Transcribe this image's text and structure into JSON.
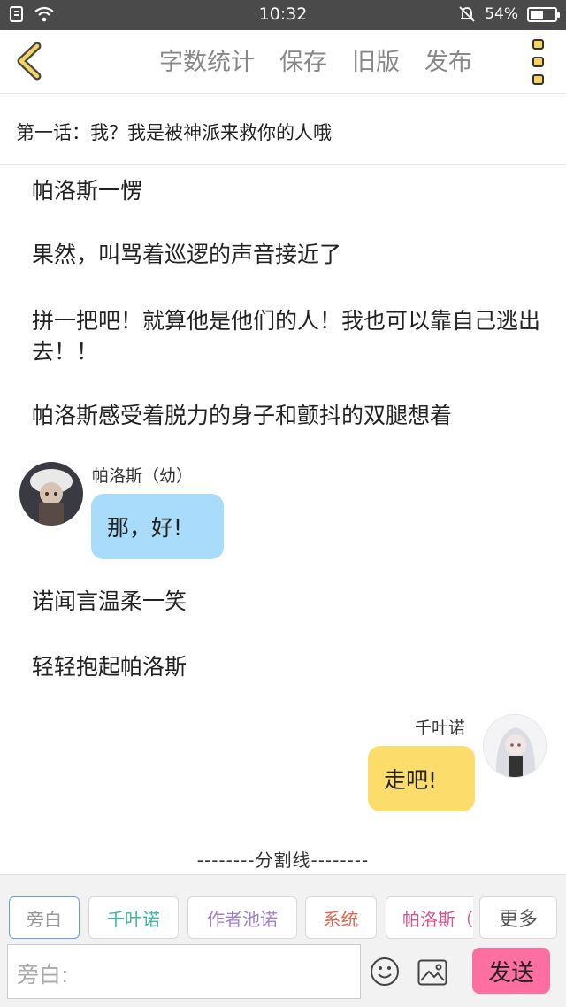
{
  "status_bar": {
    "time": "10:32",
    "battery_percent": "54%",
    "battery_level": 0.54
  },
  "toolbar": {
    "word_count": "字数统计",
    "save": "保存",
    "old_version": "旧版",
    "publish": "发布"
  },
  "chapter": {
    "title": "第一话：我？我是被神派来救你的人哦"
  },
  "content": {
    "p1": "帕洛斯一愣",
    "p2": "果然，叫骂着巡逻的声音接近了",
    "p3": "拼一把吧！就算他是他们的人！我也可以靠自己逃出去！！",
    "p4": "帕洛斯感受着脱力的身子和颤抖的双腿想着",
    "msg1": {
      "name": "帕洛斯（幼）",
      "text": "那，好!",
      "bubble_color": "#a9dcfa"
    },
    "p5": "诺闻言温柔一笑",
    "p6": "轻轻抱起帕洛斯",
    "msg2": {
      "name": "千叶诺",
      "text": "走吧!",
      "bubble_color": "#fcdc6a"
    },
    "divider": "--------分割线--------"
  },
  "roles": {
    "chips": [
      {
        "label": "旁白",
        "color": "#999999",
        "active": true
      },
      {
        "label": "千叶诺",
        "color": "#3cb7a8",
        "active": false
      },
      {
        "label": "作者池诺",
        "color": "#a27fd0",
        "active": false
      },
      {
        "label": "系统",
        "color": "#e06a4f",
        "active": false
      },
      {
        "label": "帕洛斯（幼）",
        "color": "#d9548f",
        "active": false
      }
    ],
    "more": "更多"
  },
  "composer": {
    "placeholder": "旁白:",
    "send": "发送"
  }
}
